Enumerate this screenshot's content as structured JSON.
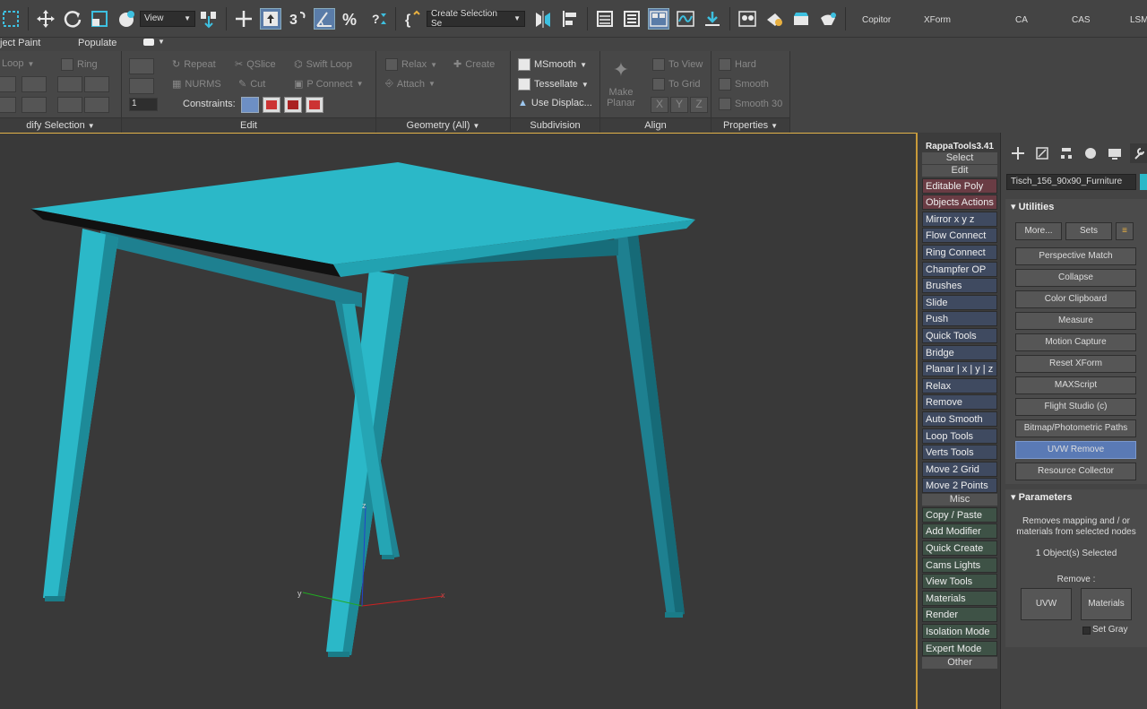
{
  "toolbar": {
    "view_dropdown": "View",
    "selection_set_dropdown": "Create Selection Se",
    "custom_buttons": [
      "Copitor",
      "XForm",
      "CA",
      "CAS",
      "LSM"
    ]
  },
  "ribbon_tabs": [
    "ject Paint",
    "Populate"
  ],
  "ribbon": {
    "modify_selection": {
      "footer": "dify Selection",
      "loop": "Loop",
      "ring": "Ring"
    },
    "edit": {
      "footer": "Edit",
      "repeat": "Repeat",
      "qslice": "QSlice",
      "swift_loop": "Swift Loop",
      "nurms": "NURMS",
      "cut": "Cut",
      "p_connect": "P Connect",
      "constraints": "Constraints:",
      "spinner_value": "1"
    },
    "geometry": {
      "footer": "Geometry (All)",
      "relax": "Relax",
      "create": "Create",
      "attach": "Attach"
    },
    "subdivision": {
      "footer": "Subdivision",
      "msmooth": "MSmooth",
      "tessellate": "Tessellate",
      "use_displace": "Use Displac..."
    },
    "make_planar": {
      "label1": "Make",
      "label2": "Planar"
    },
    "align": {
      "footer": "Align",
      "to_view": "To View",
      "to_grid": "To Grid",
      "x": "X",
      "y": "Y",
      "z": "Z"
    },
    "properties": {
      "footer": "Properties",
      "hard": "Hard",
      "smooth": "Smooth",
      "smooth30": "Smooth 30"
    }
  },
  "viewport": {
    "axis_labels": {
      "x": "x",
      "y": "y",
      "z": "z"
    },
    "object_color": "#2bb8c8"
  },
  "rappa": {
    "title": "RappaTools3.41",
    "sections": {
      "select": "Select",
      "edit": "Edit",
      "misc": "Misc",
      "other": "Other"
    },
    "edit_items": [
      "Editable Poly",
      "Objects Actions",
      "Mirror    x  y  z",
      "Flow Connect",
      "Ring Connect",
      "Champfer OP",
      "Brushes",
      "Slide",
      "Push",
      "Quick Tools",
      "Bridge",
      "Planar | x | y | z",
      "Relax",
      "Remove",
      "Auto Smooth",
      "Loop Tools",
      "Verts Tools",
      "Move 2 Grid",
      "Move 2 Points"
    ],
    "misc_items": [
      "Copy / Paste",
      "Add Modifier",
      "Quick Create",
      "Cams Lights",
      "View Tools",
      "Materials",
      "Render",
      "Isolation Mode",
      "Expert Mode"
    ]
  },
  "command_panel": {
    "object_name": "Tisch_156_90x90_Furniture",
    "utilities": {
      "title": "Utilities",
      "more_button": "More...",
      "sets_button": "Sets",
      "items": [
        "Perspective Match",
        "Collapse",
        "Color Clipboard",
        "Measure",
        "Motion Capture",
        "Reset XForm",
        "MAXScript",
        "Flight Studio (c)",
        "Bitmap/Photometric Paths",
        "UVW Remove",
        "Resource Collector"
      ],
      "selected": "UVW Remove"
    },
    "parameters": {
      "title": "Parameters",
      "description": "Removes mapping and / or materials from selected nodes",
      "selected_count": "1 Object(s) Selected",
      "remove_label": "Remove :",
      "uvw_button": "UVW",
      "materials_button": "Materials",
      "set_gray": "Set Gray"
    }
  }
}
